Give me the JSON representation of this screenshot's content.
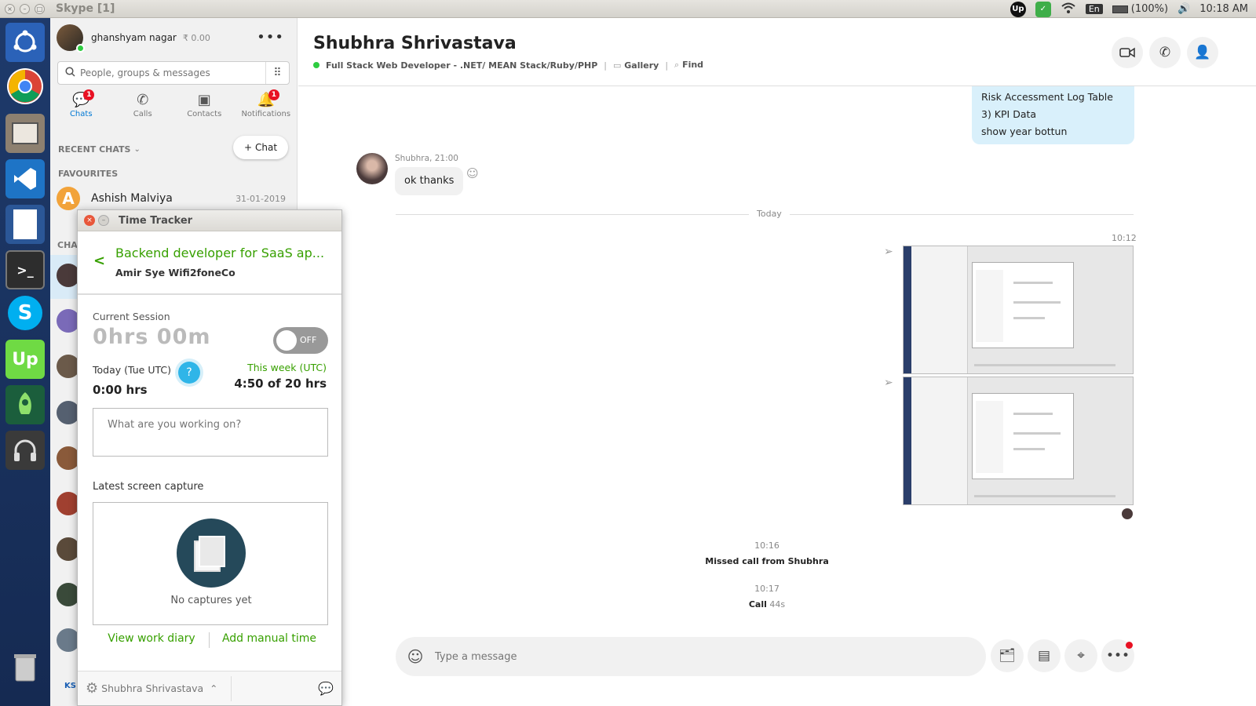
{
  "window": {
    "title": "Skype [1]"
  },
  "tray": {
    "keyboard": "En",
    "battery": "(100%)",
    "time": "10:18 AM"
  },
  "profile": {
    "name": "ghanshyam nagar",
    "balance": "₹ 0.00"
  },
  "search": {
    "placeholder": "People, groups & messages"
  },
  "tabs": [
    {
      "label": "Chats",
      "badge": "1"
    },
    {
      "label": "Calls"
    },
    {
      "label": "Contacts"
    },
    {
      "label": "Notifications",
      "badge": "1"
    }
  ],
  "recent_chats_label": "RECENT CHATS",
  "new_chat_label": "Chat",
  "favourites_label": "FAVOURITES",
  "favourite_contact": {
    "name": "Ashish Malviya",
    "date": "31-01-2019",
    "initial": "A"
  },
  "sidebar_fragments": {
    "chats_section": "CHA",
    "bottom_initials": "KS"
  },
  "conversation": {
    "name": "Shubhra Shrivastava",
    "headline": "Full Stack Web Developer - .NET/ MEAN Stack/Ruby/PHP",
    "gallery": "Gallery",
    "find": "Find",
    "outgoing_lines": [
      "Risk Accessment Log Table",
      "3) KPI Data",
      "show year bottun"
    ],
    "incoming_meta": "Shubhra, 21:00",
    "incoming_text": "ok thanks",
    "day_divider": "Today",
    "images_time": "10:12",
    "events": [
      {
        "time": "10:16",
        "text": "Missed call from Shubhra"
      },
      {
        "time": "10:17",
        "text": "Call",
        "duration": "44s"
      }
    ],
    "composer_placeholder": "Type a message"
  },
  "time_tracker": {
    "title": "Time Tracker",
    "job_title": "Backend developer for SaaS ap...",
    "client": "Amir Sye Wifi2foneCo",
    "current_session_label": "Current Session",
    "session_time": "0hrs 00m",
    "toggle_label": "OFF",
    "today_label": "Today (Tue UTC)",
    "today_value": "0:00 hrs",
    "week_label": "This week (UTC)",
    "week_value": "4:50 of 20 hrs",
    "working_on_placeholder": "What are you working on?",
    "latest_capture_label": "Latest screen capture",
    "no_captures": "No captures yet",
    "view_diary": "View work diary",
    "add_manual": "Add manual time",
    "footer_user": "Shubhra Shrivastava"
  }
}
